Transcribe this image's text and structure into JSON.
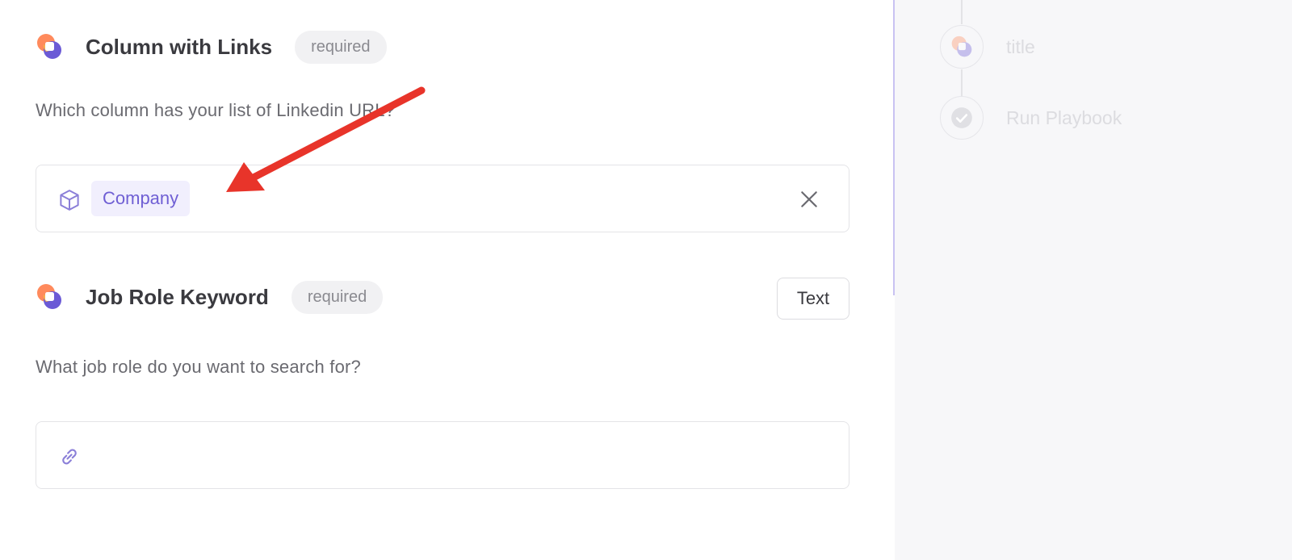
{
  "fields": [
    {
      "title": "Column with Links",
      "badge": "required",
      "description": "Which column has your list of Linkedin URL?",
      "value_chip": "Company"
    },
    {
      "title": "Job Role Keyword",
      "badge": "required",
      "description": "What job role do you want to search for?",
      "type_button": "Text",
      "value": ""
    }
  ],
  "sidebar": {
    "steps": [
      {
        "label": "title",
        "icon": "playbook-logo-icon"
      },
      {
        "label": "Run Playbook",
        "icon": "check-circle-icon"
      }
    ]
  },
  "colors": {
    "accent": "#6f5fd4",
    "chip_bg": "#f1effd",
    "annotation_arrow": "#e8342a",
    "sidebar_bg": "#f7f7f9"
  }
}
